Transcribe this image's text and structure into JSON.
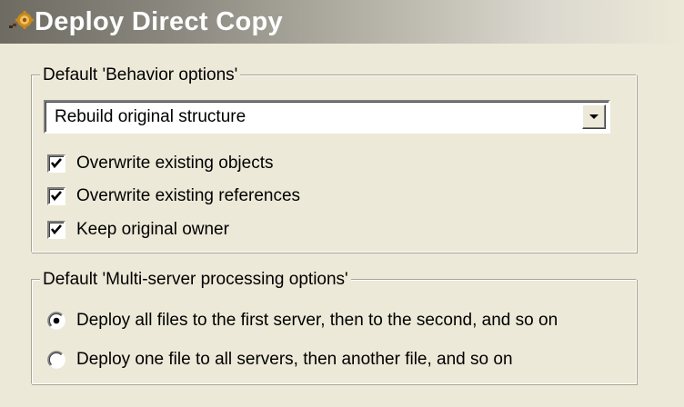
{
  "dialog": {
    "title": "Deploy Direct Copy",
    "icon": "deploy-gear-icon"
  },
  "behavior_group": {
    "legend": "Default 'Behavior options'",
    "structure_select": {
      "selected": "Rebuild original structure"
    },
    "checkboxes": [
      {
        "label": "Overwrite existing objects",
        "checked": true
      },
      {
        "label": "Overwrite existing references",
        "checked": true
      },
      {
        "label": "Keep original owner",
        "checked": true
      }
    ]
  },
  "multiserver_group": {
    "legend": "Default 'Multi-server processing options'",
    "radios": [
      {
        "label": "Deploy all files to the first server, then to the second, and so on",
        "selected": true
      },
      {
        "label": "Deploy one file to all servers, then another file, and so on",
        "selected": false
      }
    ]
  },
  "colors": {
    "dialog_bg": "#ece9d8",
    "title_text": "#ffffff",
    "header_gradient_start": "#6d6b62"
  }
}
